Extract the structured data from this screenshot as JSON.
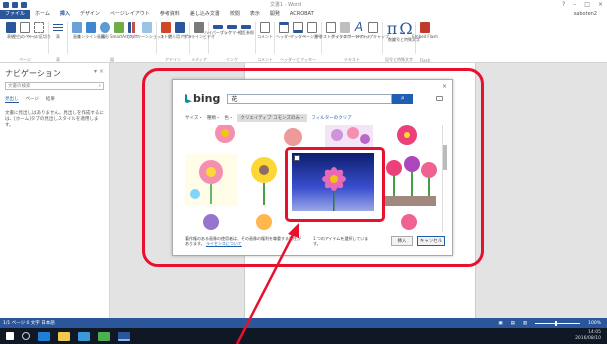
{
  "title_bar": {
    "title": "文書1 - Word",
    "window_controls": [
      "?",
      "–",
      "□",
      "×"
    ]
  },
  "tabs": [
    "ファイル",
    "ホーム",
    "挿入",
    "デザイン",
    "ページレイアウト",
    "参考資料",
    "差し込み文書",
    "校閲",
    "表示",
    "開発",
    "ACROBAT"
  ],
  "user": "saboten2",
  "ribbon": {
    "groups": [
      {
        "label": "ページ",
        "buttons": [
          "表紙",
          "空白のページ",
          "ページ区切り"
        ]
      },
      {
        "label": "表",
        "buttons": [
          "表"
        ]
      },
      {
        "label": "図",
        "buttons": [
          "画像",
          "オンライン画像",
          "図形",
          "SmartArt",
          "グラフ",
          "スクリーンショット"
        ]
      },
      {
        "label": "アドイン",
        "buttons": [
          "ストア",
          "個人用アプリ"
        ]
      },
      {
        "label": "メディア",
        "buttons": [
          "オンラインビデオ"
        ]
      },
      {
        "label": "リンク",
        "buttons": [
          "ハイパーリンク",
          "ブックマーク",
          "相互参照"
        ]
      },
      {
        "label": "コメント",
        "buttons": [
          "コメント"
        ]
      },
      {
        "label": "ヘッダーとフッター",
        "buttons": [
          "ヘッダー",
          "フッター",
          "ページ番号"
        ]
      },
      {
        "label": "テキスト",
        "buttons": [
          "テキストボックス",
          "クイックパーツ",
          "ワードアート",
          "ドロップキャップ"
        ]
      },
      {
        "label": "記号と特殊文字",
        "buttons": [
          "数式",
          "記号と特殊文字"
        ]
      },
      {
        "label": "Flash",
        "buttons": [
          "Embed Flash"
        ]
      }
    ]
  },
  "nav": {
    "title": "ナビゲーション",
    "search_placeholder": "文書の検索",
    "tabs": [
      "見出し",
      "ページ",
      "結果"
    ],
    "message": "文書に見出しはありません。見出しを作成するには、[ホーム]タブの見出しスタイルを適用します。"
  },
  "dialog": {
    "brand": "bing",
    "query": "花",
    "filters": [
      "サイズ・",
      "種類・",
      "色・"
    ],
    "active_filter": "クリエイティブ コモンズのみ・",
    "filter_link": "フィルターのクリア",
    "license_text": "著作権のある画像の使用者は、その画像の権利を尊重する責任があります。",
    "license_link": "ライセンスについて",
    "selection_count": "1 つのアイテムを選択しています。",
    "insert_button": "挿入",
    "cancel_button": "キャンセル",
    "close_label": "×"
  },
  "status": {
    "left": "1/1 ページ  0 文字  日本語",
    "zoom": "100%"
  },
  "taskbar": {
    "time": "14:05",
    "date": "2016/08/10"
  },
  "colors": {
    "word_blue": "#2b579a",
    "bing_teal": "#0f8a9c",
    "search_blue": "#1e5fb4",
    "annotation_red": "#e8112d"
  }
}
